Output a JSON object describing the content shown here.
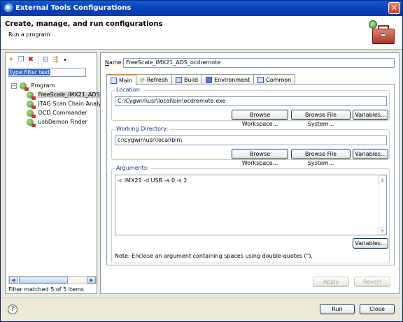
{
  "window": {
    "title": "External Tools Configurations"
  },
  "header": {
    "title": "Create, manage, and run configurations",
    "subtitle": "Run a program"
  },
  "left": {
    "toolbar": [
      {
        "icon": "new-config-icon"
      },
      {
        "icon": "duplicate-icon"
      },
      {
        "icon": "delete-icon"
      },
      {
        "icon": "collapse-all-icon"
      },
      {
        "icon": "filter-icon"
      }
    ],
    "filter_text": "type filter text",
    "tree": {
      "root": "Program",
      "items": [
        "FreeScale_iMX21_ADS_",
        "JTAG Scan Chain Analy",
        "OCD Commander",
        "usbDemon Finder"
      ]
    },
    "status": "Filter matched 5 of 5 items"
  },
  "right": {
    "name_label": "Name:",
    "name_value": "FreeScale_iMX21_ADS_ocdremote",
    "tabs": [
      "Main",
      "Refresh",
      "Build",
      "Environment",
      "Common"
    ],
    "location": {
      "label": "Location:",
      "value": "C:\\Cygwin\\usr\\local\\bin\\ocdremote.exe",
      "btn_workspace": "Browse Workspace...",
      "btn_file": "Browse File System...",
      "btn_variables": "Variables..."
    },
    "working_dir": {
      "label": "Working Directory:",
      "value": "c:\\cygwin\\usr\\local\\bin\\",
      "btn_workspace": "Browse Workspace...",
      "btn_file": "Browse File System...",
      "btn_variables": "Variables..."
    },
    "arguments": {
      "label": "Arguments:",
      "value": "-c iMX21 -d USB -a 0 -s 2",
      "btn_variables": "Variables..."
    },
    "note": "Note: Enclose an argument containing spaces using double-quotes (\").",
    "apply": "Apply",
    "revert": "Revert"
  },
  "footer": {
    "run": "Run",
    "close": "Close"
  }
}
